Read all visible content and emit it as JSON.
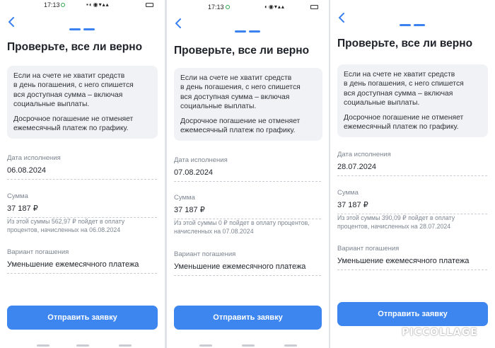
{
  "screens": [
    {
      "status_time": "17:13",
      "title": "Проверьте, все ли верно",
      "info_paragraph_1": "Если на счете не хватит средств\nв день погашения, с него спишется\nвся доступная сумма – включая\nсоциальные выплаты.",
      "info_paragraph_2": "Досрочное погашение не отменяет\nежемесячный платеж по графику.",
      "date_label": "Дата исполнения",
      "date_value": "06.08.2024",
      "amount_label": "Сумма",
      "amount_value": "37 187 ₽",
      "amount_note": "Из этой суммы 562,97 ₽ пойдет в оплату\nпроцентов, начисленных на 06.08.2024",
      "option_label": "Вариант погашения",
      "option_value": "Уменьшение ежемесячного платежа",
      "submit_label": "Отправить заявку"
    },
    {
      "status_time": "17:13",
      "title": "Проверьте, все ли верно",
      "info_paragraph_1": "Если на счете не хватит средств\nв день погашения, с него спишется\nвся доступная сумма – включая\nсоциальные выплаты.",
      "info_paragraph_2": "Досрочное погашение не отменяет\nежемесячный платеж по графику.",
      "date_label": "Дата исполнения",
      "date_value": "07.08.2024",
      "amount_label": "Сумма",
      "amount_value": "37 187 ₽",
      "amount_note": "Из этой суммы 0 ₽ пойдет в оплату процентов,\nначисленных на 07.08.2024",
      "option_label": "Вариант погашения",
      "option_value": "Уменьшение ежемесячного платежа",
      "submit_label": "Отправить заявку"
    },
    {
      "status_time": "",
      "title": "Проверьте, все ли верно",
      "info_paragraph_1": "Если на счете не хватит средств\nв день погашения, с него спишется\nвся доступная сумма – включая\nсоциальные выплаты.",
      "info_paragraph_2": "Досрочное погашение не отменяет\nежемесячный платеж по графику.",
      "date_label": "Дата исполнения",
      "date_value": "28.07.2024",
      "amount_label": "Сумма",
      "amount_value": "37 187 ₽",
      "amount_note": "Из этой суммы 390,09 ₽ пойдет в оплату\nпроцентов, начисленных на 28.07.2024",
      "option_label": "Вариант погашения",
      "option_value": "Уменьшение ежемесячного платежа",
      "submit_label": "Отправить заявку"
    }
  ],
  "watermark": "PICCOLLAGE",
  "icons": {
    "back": "chevron-left-icon",
    "sync": "sync-check-icon",
    "battery": "battery-icon",
    "signal": "signal-icon"
  },
  "colors": {
    "accent": "#3d86ef",
    "step_indicator": "#3b82f0",
    "card_background": "#f0f2f5",
    "muted_text": "#7d8590"
  }
}
